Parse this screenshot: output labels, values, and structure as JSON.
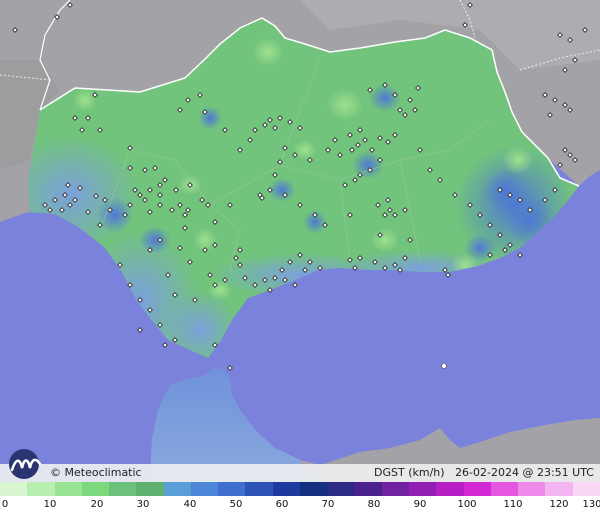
{
  "brand": {
    "copyright_label": "© Meteoclimatic"
  },
  "caption": {
    "variable": "DGST (km/h)",
    "timestamp": "26-02-2024 @ 23:51 UTC"
  },
  "legend": {
    "ticks": [
      "0",
      "10",
      "20",
      "30",
      "40",
      "50",
      "60",
      "70",
      "80",
      "90",
      "100",
      "110",
      "120",
      "130"
    ],
    "colors": [
      "#d8f7d0",
      "#b8efb0",
      "#97e392",
      "#7dd87d",
      "#6cc27a",
      "#5fb06f",
      "#5a9ed8",
      "#4d86d8",
      "#3f6ed0",
      "#2d52b8",
      "#1d3a9e",
      "#14307f",
      "#2b2a85",
      "#4b208f",
      "#7122a0",
      "#9320b4",
      "#b61fc6",
      "#d229d4",
      "#e455e0",
      "#ee8ae9",
      "#f4b4f0",
      "#f8d6f5"
    ]
  },
  "map": {
    "colors": {
      "sea": "#7b82dc",
      "land_outside": "#a3a3a7",
      "region_green": "#72c47c",
      "coast_blue": "#8fa8dc",
      "africa_blue": "#7f9fdc",
      "border": "#ffffff",
      "station": "#ffffff"
    },
    "icons": [
      "station-marker-icon",
      "meteoclimatic-logo-icon"
    ]
  }
}
